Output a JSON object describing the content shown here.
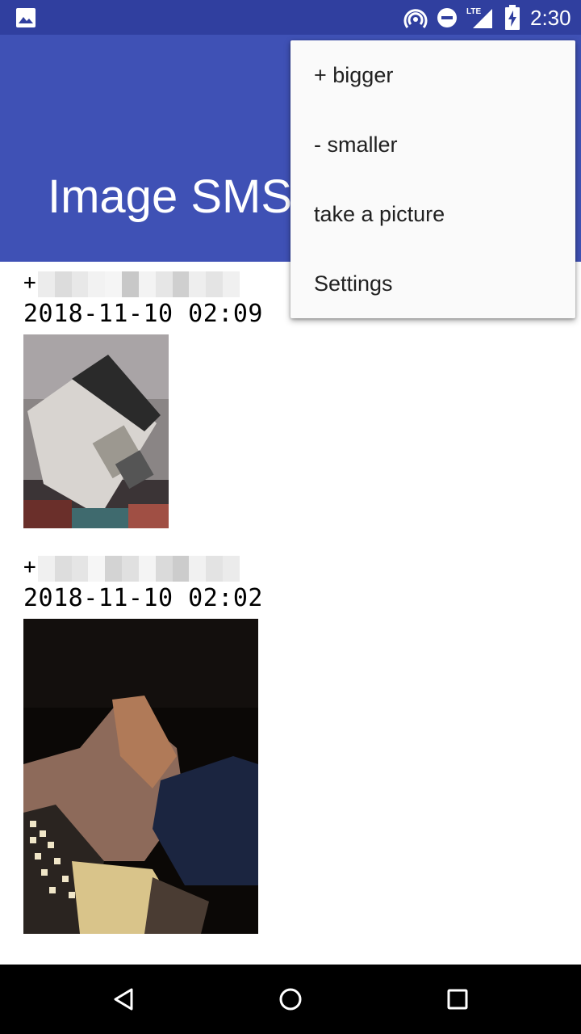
{
  "status_bar": {
    "time": "2:30",
    "icons": [
      "gallery-icon",
      "hotspot-icon",
      "do-not-disturb-icon",
      "lte-signal-icon",
      "battery-charging-icon"
    ],
    "network_label": "LTE"
  },
  "app_bar": {
    "title": "Image SMS"
  },
  "messages": [
    {
      "phone_prefix": "+",
      "date": "2018-11-10 02:09"
    },
    {
      "phone_prefix": "+",
      "date": "2018-11-10 02:02"
    }
  ],
  "menu": {
    "items": [
      {
        "label": "+ bigger"
      },
      {
        "label": "- smaller"
      },
      {
        "label": "take a picture"
      },
      {
        "label": "Settings"
      }
    ]
  },
  "nav_bar": {
    "icons": [
      "back-icon",
      "home-icon",
      "recents-icon"
    ]
  },
  "colors": {
    "status_bar": "#303f9f",
    "app_bar": "#3f51b5",
    "menu_bg": "#fafafa",
    "nav_bar": "#000000"
  }
}
